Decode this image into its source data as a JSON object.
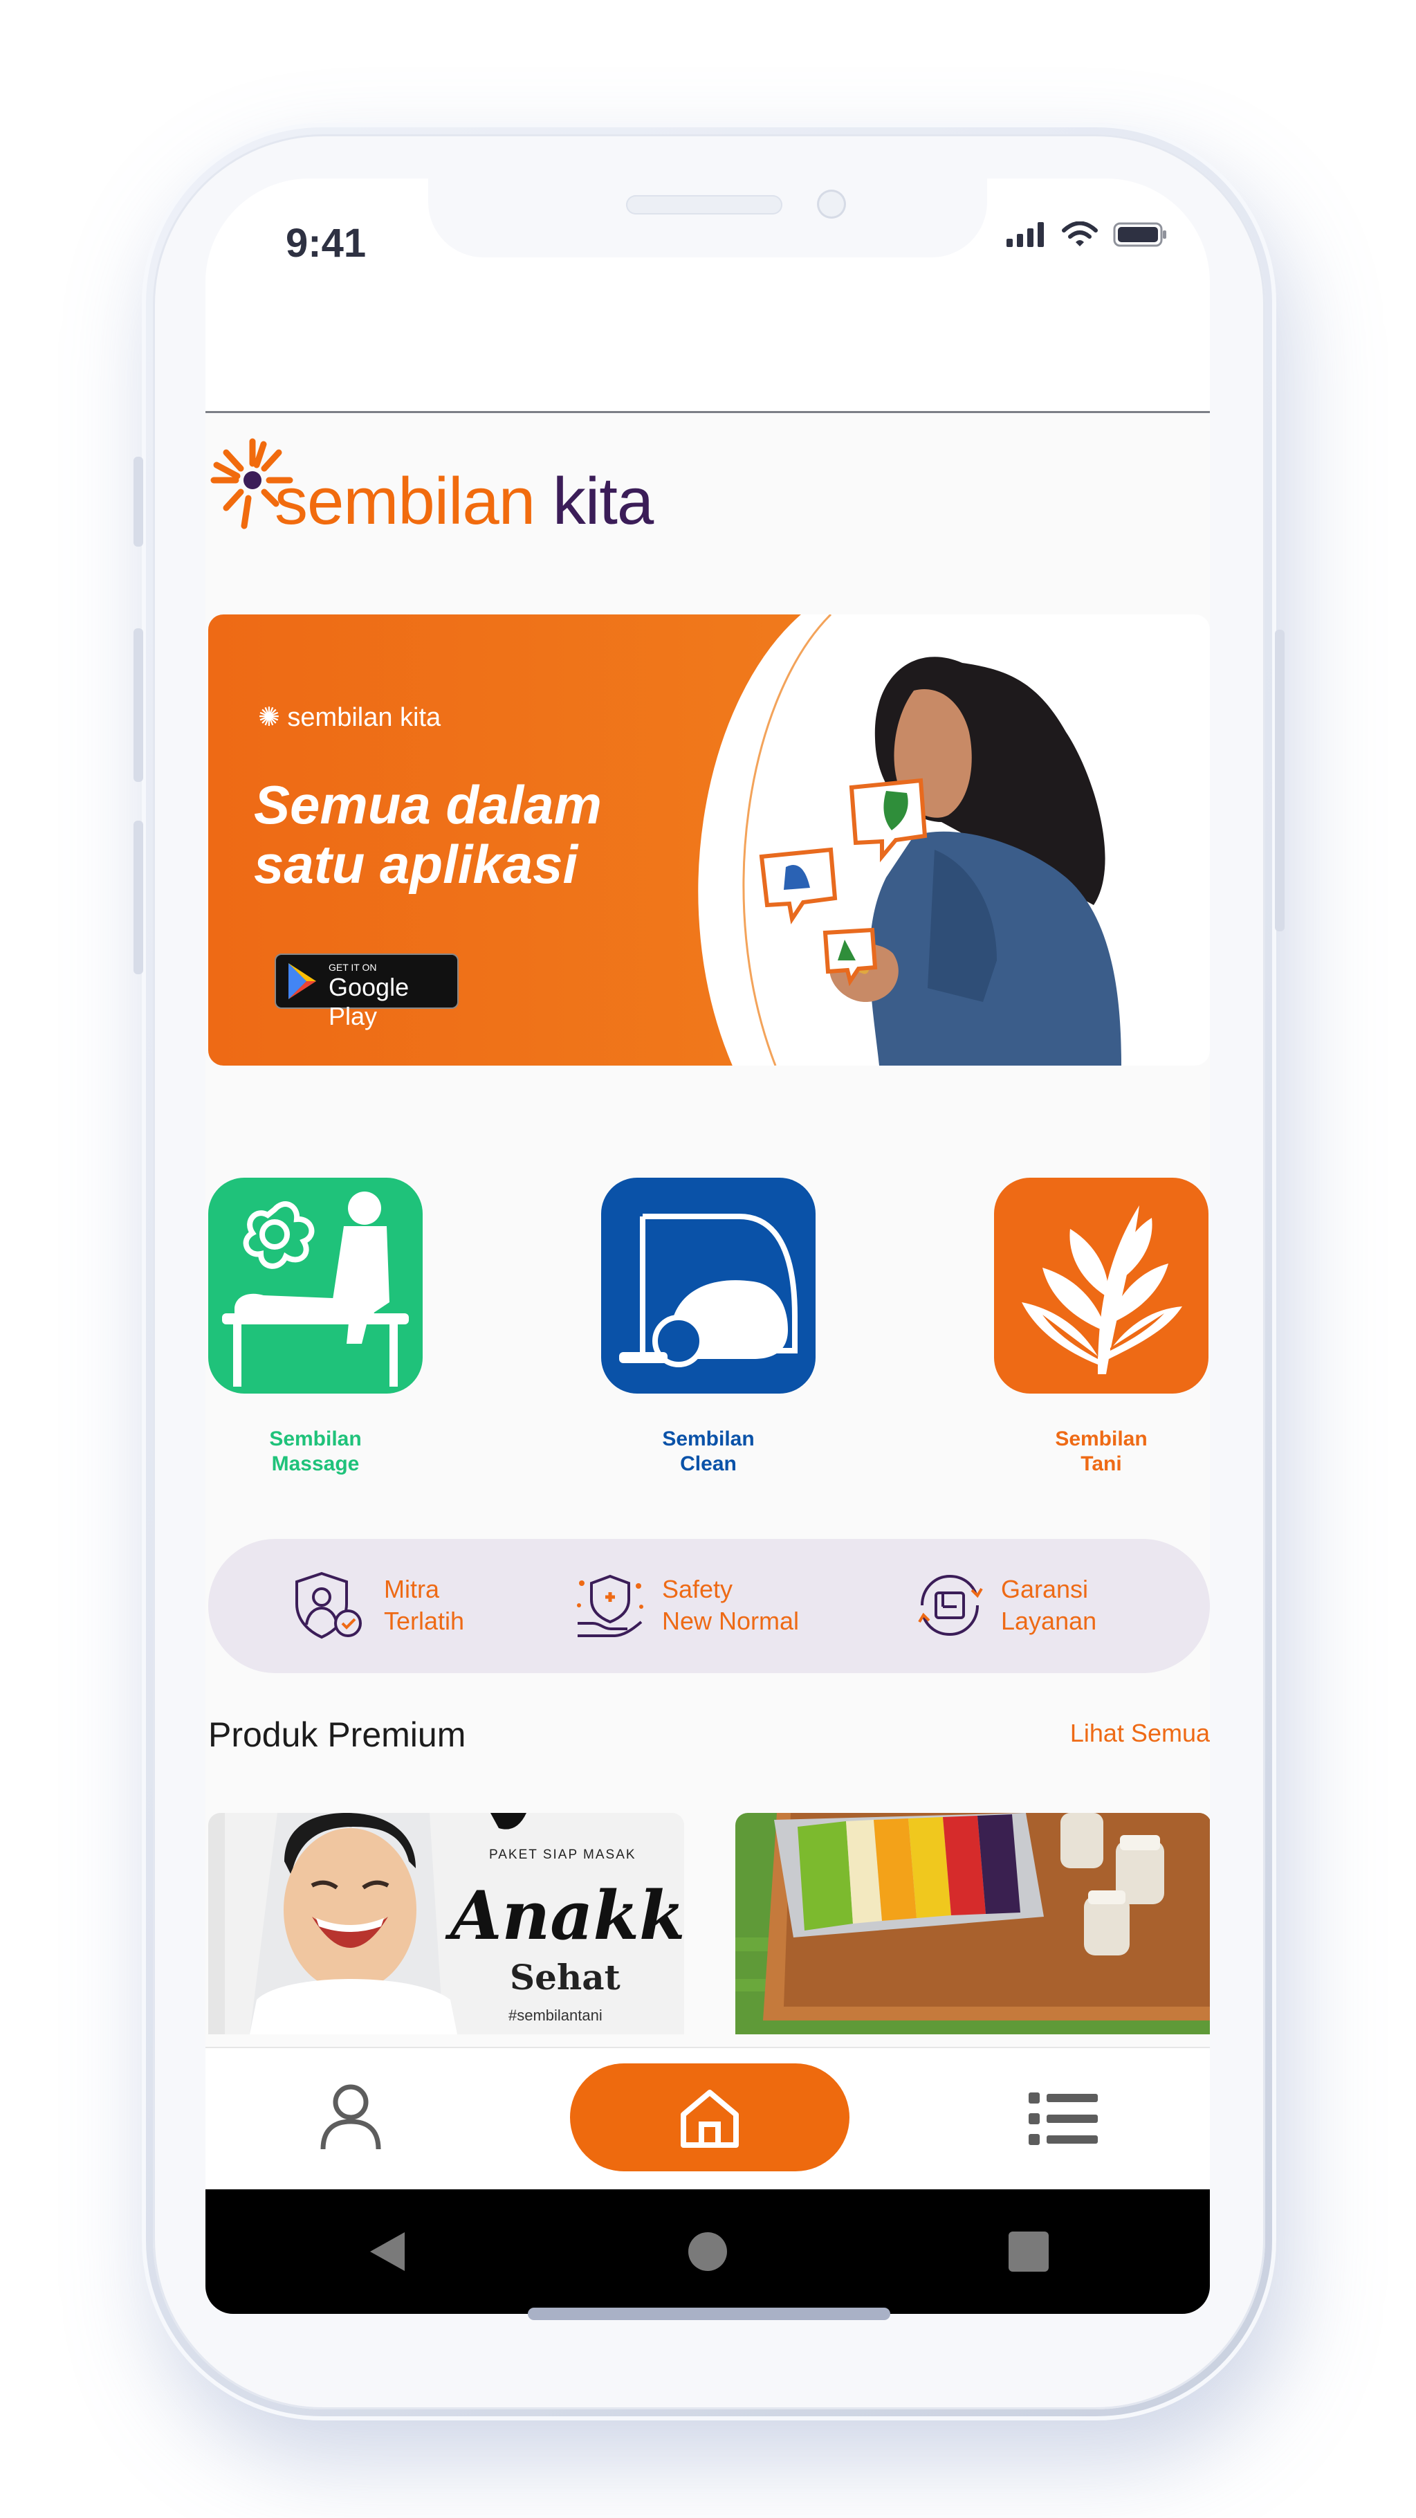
{
  "status_bar": {
    "time": "9:41"
  },
  "app": {
    "logo_word1": "sembilan",
    "logo_word2": "kita"
  },
  "banner": {
    "logo_text": "sembilan kita",
    "headline_line1": "Semua dalam",
    "headline_line2": "satu aplikasi",
    "store_badge_small": "GET IT ON",
    "store_badge_big": "Google Play",
    "active_slide_index": 1,
    "slide_count": 3
  },
  "services": [
    {
      "line1": "Sembilan",
      "line2": "Massage",
      "color": "#1fc27a"
    },
    {
      "line1": "Sembilan",
      "line2": "Clean",
      "color": "#0a52a8"
    },
    {
      "line1": "Sembilan",
      "line2": "Tani",
      "color": "#ee6a15"
    }
  ],
  "features": [
    {
      "line1": "Mitra",
      "line2": "Terlatih",
      "icon": "trained-partner-icon"
    },
    {
      "line1": "Safety",
      "line2": "New Normal",
      "icon": "safety-shield-icon"
    },
    {
      "line1": "Garansi",
      "line2": "Layanan",
      "icon": "guarantee-icon"
    }
  ],
  "premium": {
    "title": "Produk Premium",
    "see_all": "Lihat Semua",
    "products": [
      {
        "tag": "PAKET SIAP MASAK",
        "title1": "Anakku",
        "title2": "Sehat",
        "hashtag": "#sembilantani"
      },
      {
        "image": "fruit-tray-image"
      }
    ]
  },
  "colors": {
    "brand_orange": "#ee6a15",
    "brand_purple": "#3b1d58"
  }
}
